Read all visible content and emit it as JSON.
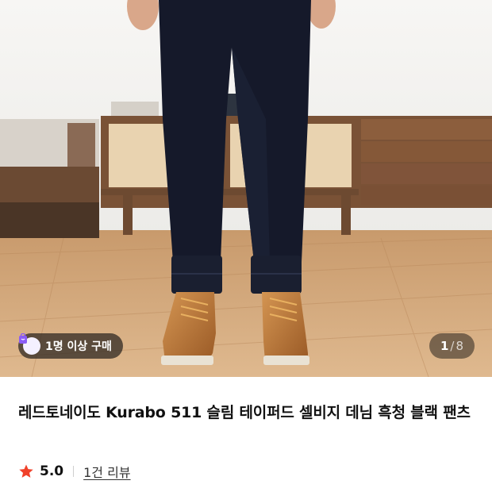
{
  "hero": {
    "purchase_badge": "1명 이상 구매",
    "page_current": "1",
    "page_separator": "/",
    "page_total": "8"
  },
  "product": {
    "title": "레드토네이도 Kurabo 511 슬림 테이퍼드 셀비지 데님 흑청 블랙 팬츠",
    "rating": "5.0",
    "review_link": "1건 리뷰"
  },
  "colors": {
    "star": "#f0412a",
    "badge_icon": "#8b5cf6"
  }
}
